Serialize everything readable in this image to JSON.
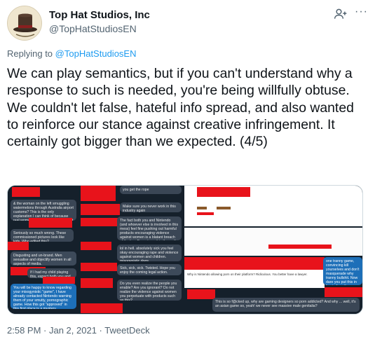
{
  "author": {
    "name": "Top Hat Studios, Inc",
    "handle": "@TopHatStudiosEN"
  },
  "reply": {
    "prefix": "Replying to",
    "to": "@TopHatStudiosEN"
  },
  "tweet": {
    "text": "We can play semantics, but if you can't understand why a response to such is needed, you're being willfully obtuse. We couldn't let false, hateful info spread, and also wanted to reinforce our stance against creative infringement. It certainly got bigger than we expected. (4/5)"
  },
  "media": {
    "chat_bubbles": [
      "& the woman on the left smuggling watermelons through Australia airport customs? This is the only explanation I can think of because real women do not look like that. Sort it out Nintendo. Sack the cover game designers.",
      "Make sure you never work in this industry again",
      "The fact both you and Nintendo (and whoever else is involved in this mess) feel fine pushing out harmful products encouraging violence against women is a blatant breach of the law. Expect a writ in the mail sometime soon.",
      "lol in hell. absolutely sick you feel okay encouraging rape and violence against women and children. misogynistic dogs",
      "Sick, sick, sick. Twisted. Hope you enjoy the coming legal action.",
      "Do you even realize the people you enable? Are you ignorant? Do not realize the violence against women you perpetuate with products such as this?",
      "You will be happy to know regarding your misogynistic \"game\", I have already contacted Nintendo warning them of your smutty, pornographic game. How this got \"approved\" in this first place is a mystery.",
      "Disgusting and un-brand. Men sexualise and objectify women in all aspects of media.",
      "If I had my child playing this, expect both you and NINTENDO to hear from both me and my lawyer",
      "Seriously so much wrong. These commissioned pictures look like kids. Who edited this?",
      "one tranny game, convincing kill yourselves and don't masquerade why tranny bullshit. Now dare you put this in front of youth.",
      "This is so f@cked up, why are gaming designers so porn addicted? And why ... well, it's an asian game so, yeah! we never see massive male genitalia?",
      "Why is Nintendo allowing porn on their platform? Ridiculous. You better have a lawyer.",
      "you get the rope"
    ]
  },
  "meta": {
    "time": "2:58 PM",
    "sep1": " · ",
    "date": "Jan 2, 2021",
    "sep2": " · ",
    "source": "TweetDeck"
  },
  "colors": {
    "link": "#1d9bf0",
    "secondary": "#536471",
    "dark_bg": "#15202b",
    "censor_red": "#e8131b"
  },
  "icons": [
    "avatar-top-hat-icon",
    "follow-person-icon",
    "more-options-icon"
  ]
}
